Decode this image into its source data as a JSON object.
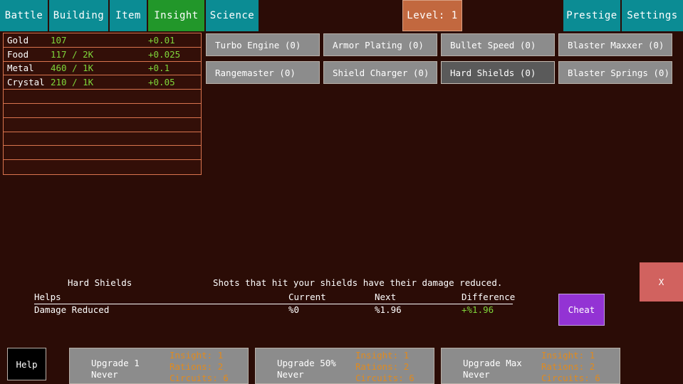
{
  "nav": {
    "tabs": [
      {
        "label": "Battle",
        "name": "tab-battle",
        "active": false
      },
      {
        "label": "Building",
        "name": "tab-building",
        "active": false
      },
      {
        "label": "Item",
        "name": "tab-item",
        "active": false
      },
      {
        "label": "Insight",
        "name": "tab-insight",
        "active": true
      },
      {
        "label": "Science",
        "name": "tab-science",
        "active": false
      }
    ],
    "level_label": "Level: 1",
    "prestige_label": "Prestige",
    "settings_label": "Settings",
    "colors": {
      "tab": "#0b8c94",
      "tab_active": "#22972a",
      "level": "#c2683f",
      "background": "#2b0c06"
    }
  },
  "resources": {
    "rows": [
      {
        "name": "Gold",
        "amount": "107",
        "rate": "+0.01"
      },
      {
        "name": "Food",
        "amount": "117 / 2K",
        "rate": "+0.025"
      },
      {
        "name": "Metal",
        "amount": "460 / 1K",
        "rate": "+0.1"
      },
      {
        "name": "Crystal",
        "amount": "210 / 1K",
        "rate": "+0.05"
      },
      {
        "name": "",
        "amount": "",
        "rate": ""
      },
      {
        "name": "",
        "amount": "",
        "rate": ""
      },
      {
        "name": "",
        "amount": "",
        "rate": ""
      },
      {
        "name": "",
        "amount": "",
        "rate": ""
      },
      {
        "name": "",
        "amount": "",
        "rate": ""
      },
      {
        "name": "",
        "amount": "",
        "rate": ""
      }
    ],
    "border_color": "#d9744e",
    "value_color": "#7fd63a"
  },
  "upgrades": [
    {
      "label": "Turbo Engine (0)",
      "name": "upgrade-turbo-engine",
      "selected": false
    },
    {
      "label": "Armor Plating (0)",
      "name": "upgrade-armor-plating",
      "selected": false
    },
    {
      "label": "Bullet Speed (0)",
      "name": "upgrade-bullet-speed",
      "selected": false
    },
    {
      "label": "Blaster Maxxer (0)",
      "name": "upgrade-blaster-maxxer",
      "selected": false
    },
    {
      "label": "Rangemaster (0)",
      "name": "upgrade-rangemaster",
      "selected": false
    },
    {
      "label": "Shield Charger (0)",
      "name": "upgrade-shield-charger",
      "selected": false
    },
    {
      "label": "Hard Shields (0)",
      "name": "upgrade-hard-shields",
      "selected": true
    },
    {
      "label": "Blaster Springs (0)",
      "name": "upgrade-blaster-springs",
      "selected": false
    }
  ],
  "detail": {
    "title": "Hard Shields",
    "description": "Shots that hit your shields have their damage reduced.",
    "headers": {
      "helps": "Helps",
      "current": "Current",
      "next": "Next",
      "difference": "Difference"
    },
    "row": {
      "helps": "Damage Reduced",
      "current": "%0",
      "next": "%1.96",
      "difference": "+%1.96"
    }
  },
  "cheat_label": "Cheat",
  "close_label": "X",
  "help_label": "Help",
  "buy_buttons": [
    {
      "name": "buy-upgrade-1",
      "label": "Upgrade 1\nNever",
      "costs": "Insight: 1\nRations: 2\nCircuits: 6"
    },
    {
      "name": "buy-upgrade-50-percent",
      "label": "Upgrade 50%\nNever",
      "costs": "Insight: 1\nRations: 2\nCircuits: 6"
    },
    {
      "name": "buy-upgrade-max",
      "label": "Upgrade Max\nNever",
      "costs": "Insight: 1\nRations: 2\nCircuits: 6"
    }
  ]
}
